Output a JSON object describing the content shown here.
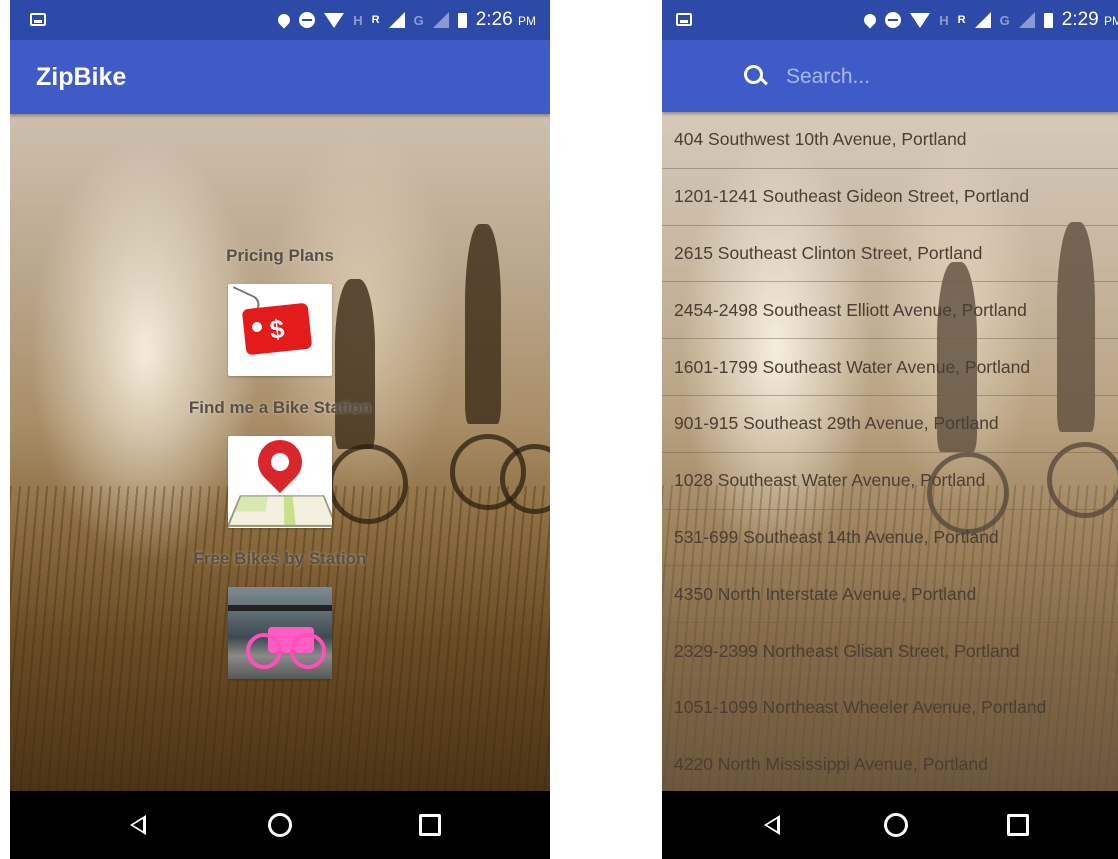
{
  "left_screen": {
    "status": {
      "time": "2:26",
      "ampm": "PM",
      "network_h": "H",
      "network_r": "R",
      "network_g": "G"
    },
    "app_title": "ZipBike",
    "menu": [
      {
        "label": "Pricing Plans",
        "icon": "price-tag-icon"
      },
      {
        "label": "Find me a Bike Station",
        "icon": "map-pin-icon"
      },
      {
        "label": "Free Bikes by Station",
        "icon": "bikes-photo-icon"
      }
    ],
    "nav": {
      "back": "back-icon",
      "home": "home-icon",
      "recents": "recents-icon"
    }
  },
  "right_screen": {
    "status": {
      "time": "2:29",
      "ampm": "PM",
      "network_h": "H",
      "network_r": "R",
      "network_g": "G"
    },
    "search": {
      "placeholder": "Search..."
    },
    "addresses": [
      "404 Southwest 10th Avenue, Portland",
      "1201-1241 Southeast Gideon Street, Portland",
      "2615 Southeast Clinton Street, Portland",
      "2454-2498 Southeast Elliott Avenue, Portland",
      "1601-1799 Southeast Water Avenue, Portland",
      "901-915 Southeast 29th Avenue, Portland",
      "1028 Southeast Water Avenue, Portland",
      "531-699 Southeast 14th Avenue, Portland",
      "4350 North Interstate Avenue, Portland",
      "2329-2399 Northeast Glisan Street, Portland",
      "1051-1099 Northeast Wheeler Avenue, Portland",
      "4220 North Mississippi Avenue, Portland"
    ]
  },
  "colors": {
    "status_bar": "#2d4aa8",
    "app_bar": "#3f5bc7",
    "nav_bar": "#000000"
  }
}
